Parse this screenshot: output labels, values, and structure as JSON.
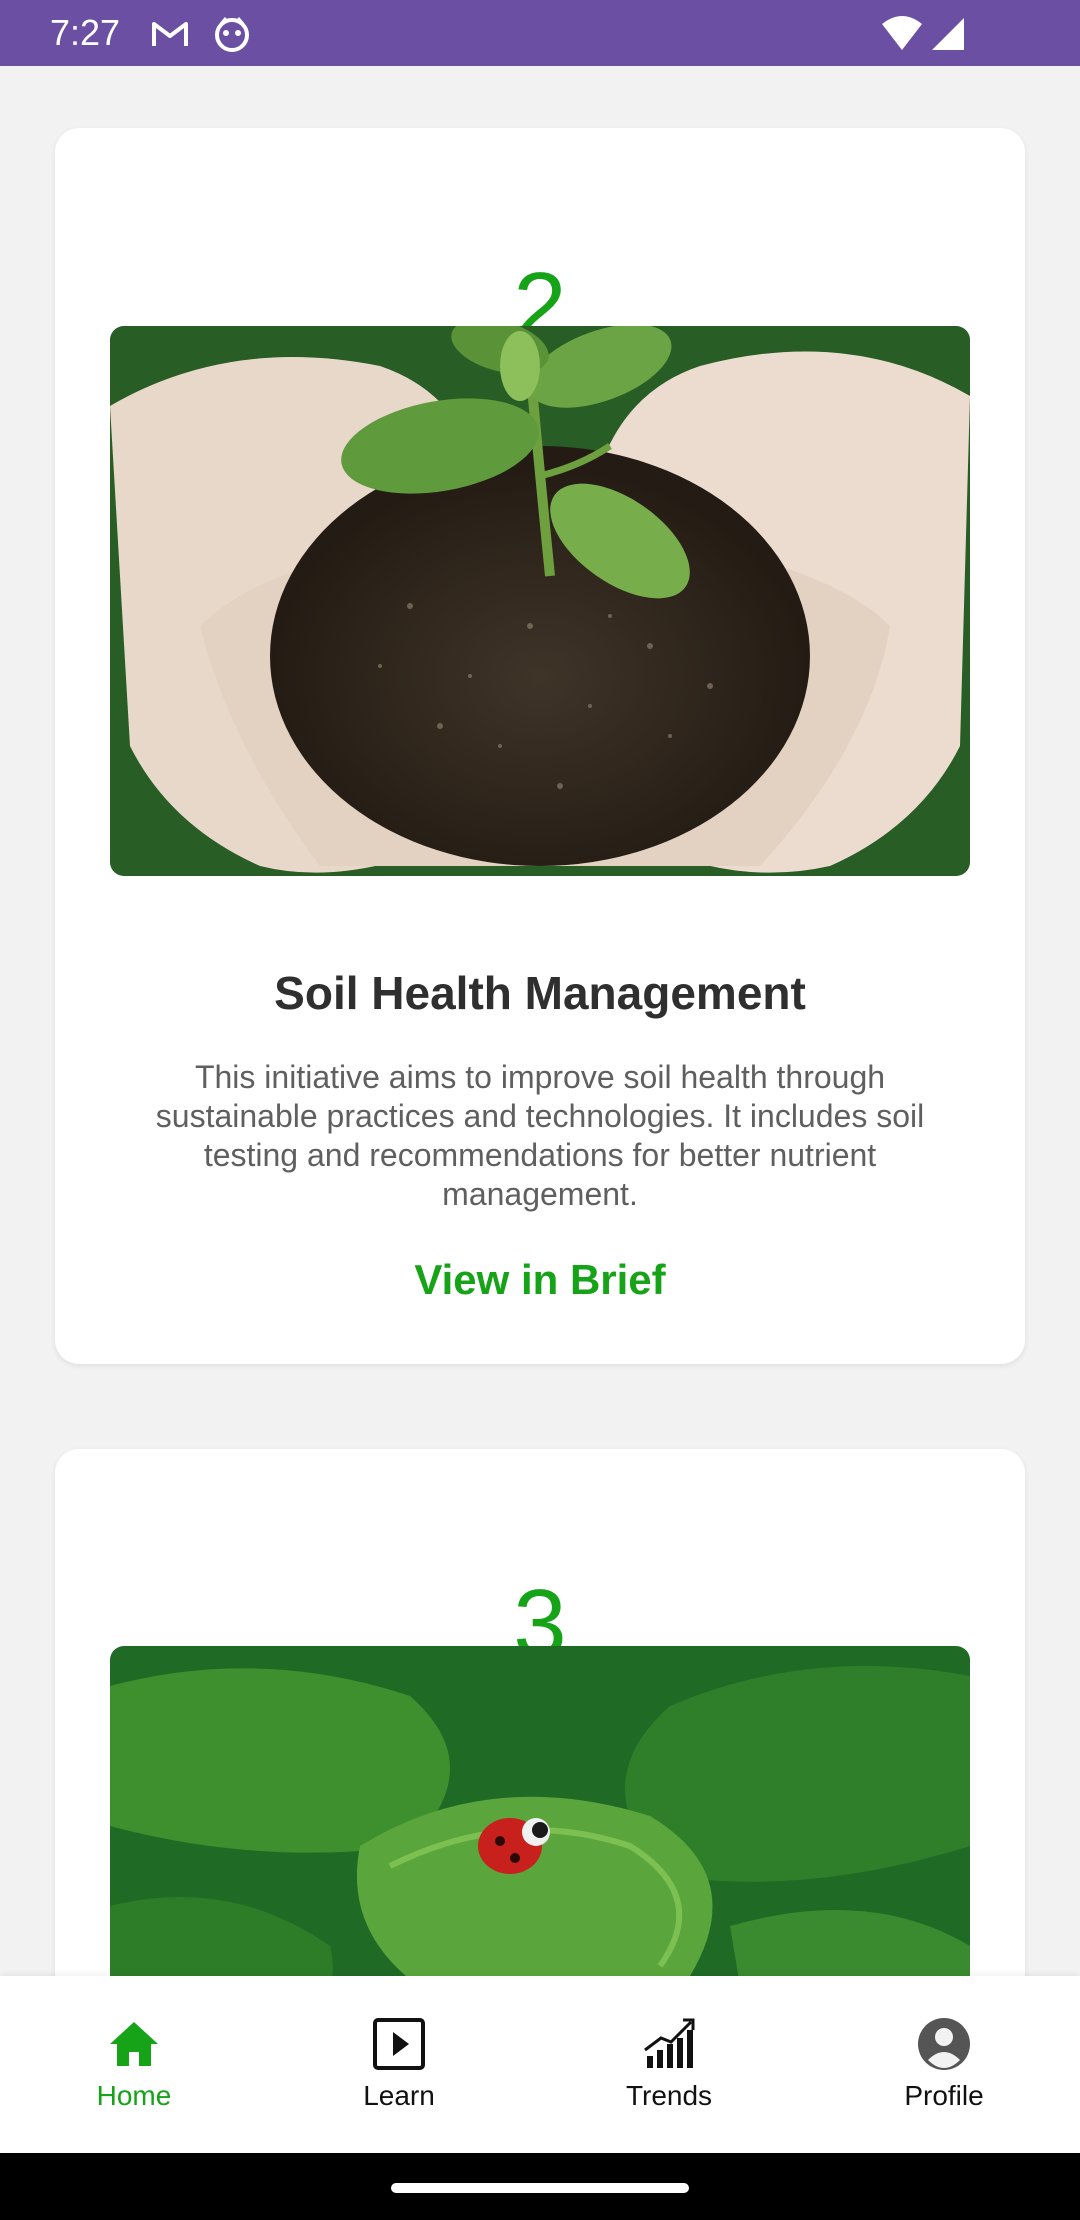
{
  "status_bar": {
    "time": "7:27",
    "icons": [
      "gmail-icon",
      "assistant-icon",
      "wifi-icon",
      "signal-icon"
    ],
    "background_color": "#6a4fa3"
  },
  "cards": [
    {
      "number": "2",
      "image": "hands-holding-soil-seedling",
      "title": "Soil Health Management",
      "description": "This initiative aims to improve soil health through sustainable practices and technologies. It includes soil testing and recommendations for better nutrient management.",
      "link_label": "View in Brief"
    },
    {
      "number": "3",
      "image": "ladybug-on-lettuce-leaves"
    }
  ],
  "bottom_nav": {
    "items": [
      {
        "label": "Home",
        "icon": "home-icon",
        "active": true
      },
      {
        "label": "Learn",
        "icon": "play-icon",
        "active": false
      },
      {
        "label": "Trends",
        "icon": "trends-chart-icon",
        "active": false
      },
      {
        "label": "Profile",
        "icon": "profile-icon",
        "active": false
      }
    ]
  },
  "colors": {
    "accent": "#17a317",
    "background": "#f2f2f2",
    "card": "#ffffff"
  }
}
